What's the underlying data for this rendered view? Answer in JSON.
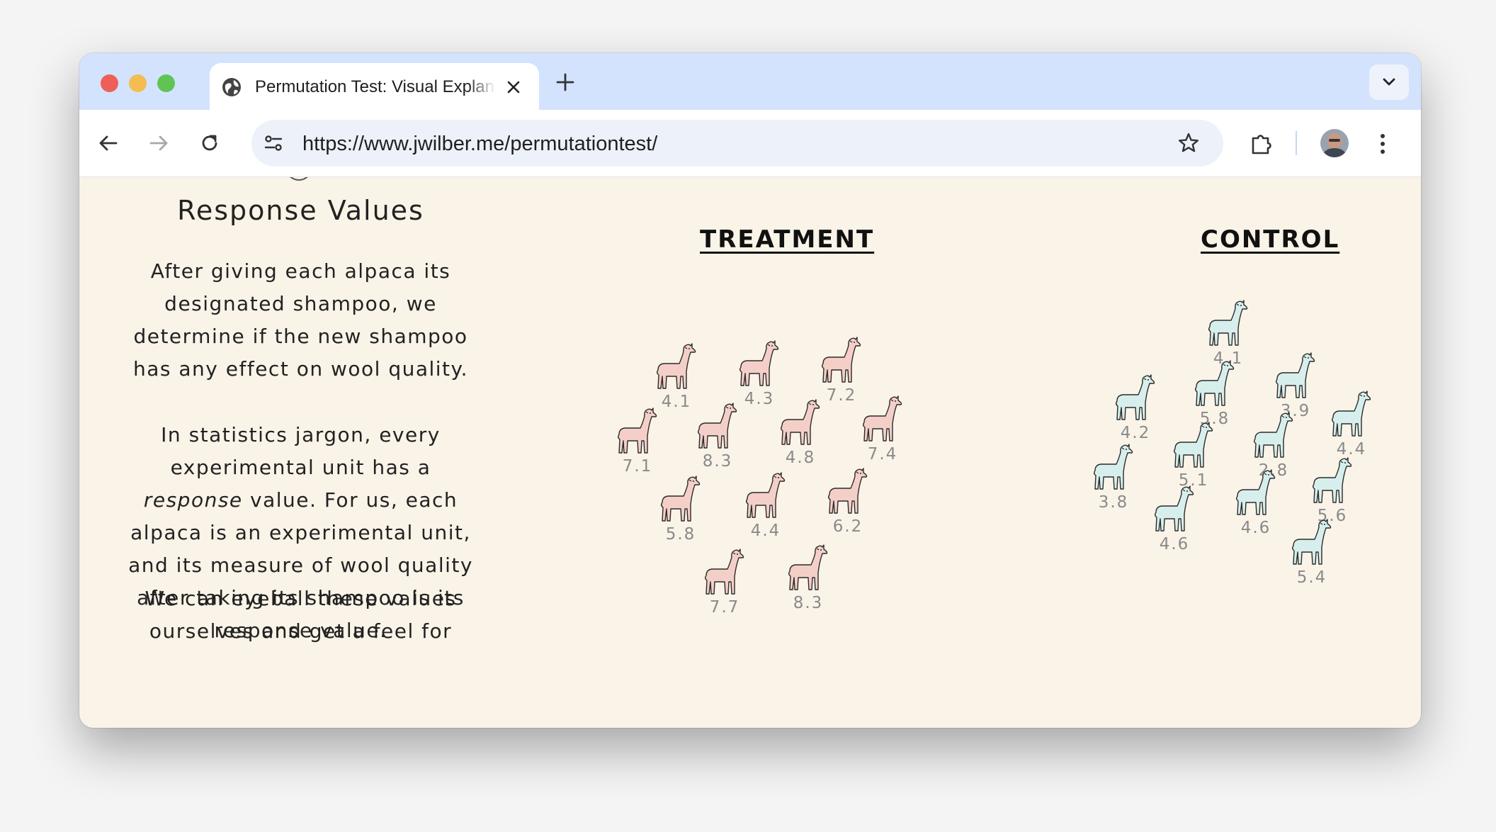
{
  "browser": {
    "tab_title": "Permutation Test: Visual Explanation",
    "url": "https://www.jwilber.me/permutationtest/",
    "icons": [
      "globe-icon",
      "close-icon",
      "plus-icon",
      "chevron-down-icon",
      "back-icon",
      "forward-icon",
      "reload-icon",
      "site-settings-icon",
      "star-icon",
      "extensions-icon",
      "avatar",
      "more-icon"
    ]
  },
  "colors": {
    "treatment_fill": "#f4cfc8",
    "control_fill": "#d7efec",
    "background": "#faf3e8",
    "value_label": "#8a8a8a"
  },
  "article": {
    "heading": "Response Values",
    "paragraph_1": "After giving each alpaca its designated shampoo, we determine if the new shampoo has any effect on wool quality.",
    "paragraph_2_part_1": "In statistics jargon, every experimental unit has a",
    "paragraph_2_emphasis": "response",
    "paragraph_2_part_2": "value. For us, each alpaca is an experimental unit, and its measure of wool quality after taking its shampoo is its response value.",
    "paragraph_3": "We can eyeball these values ourselves and get a feel for"
  },
  "groups": {
    "treatment": {
      "title": "TREATMENT",
      "values": [
        "4.1",
        "4.3",
        "7.2",
        "7.1",
        "8.3",
        "4.8",
        "7.4",
        "5.8",
        "4.4",
        "6.2",
        "7.7",
        "8.3"
      ]
    },
    "control": {
      "title": "CONTROL",
      "values": [
        "4.1",
        "4.2",
        "5.8",
        "3.9",
        "4.4",
        "2.8",
        "5.1",
        "3.8",
        "5.6",
        "4.6",
        "4.6",
        "5.4"
      ]
    }
  }
}
